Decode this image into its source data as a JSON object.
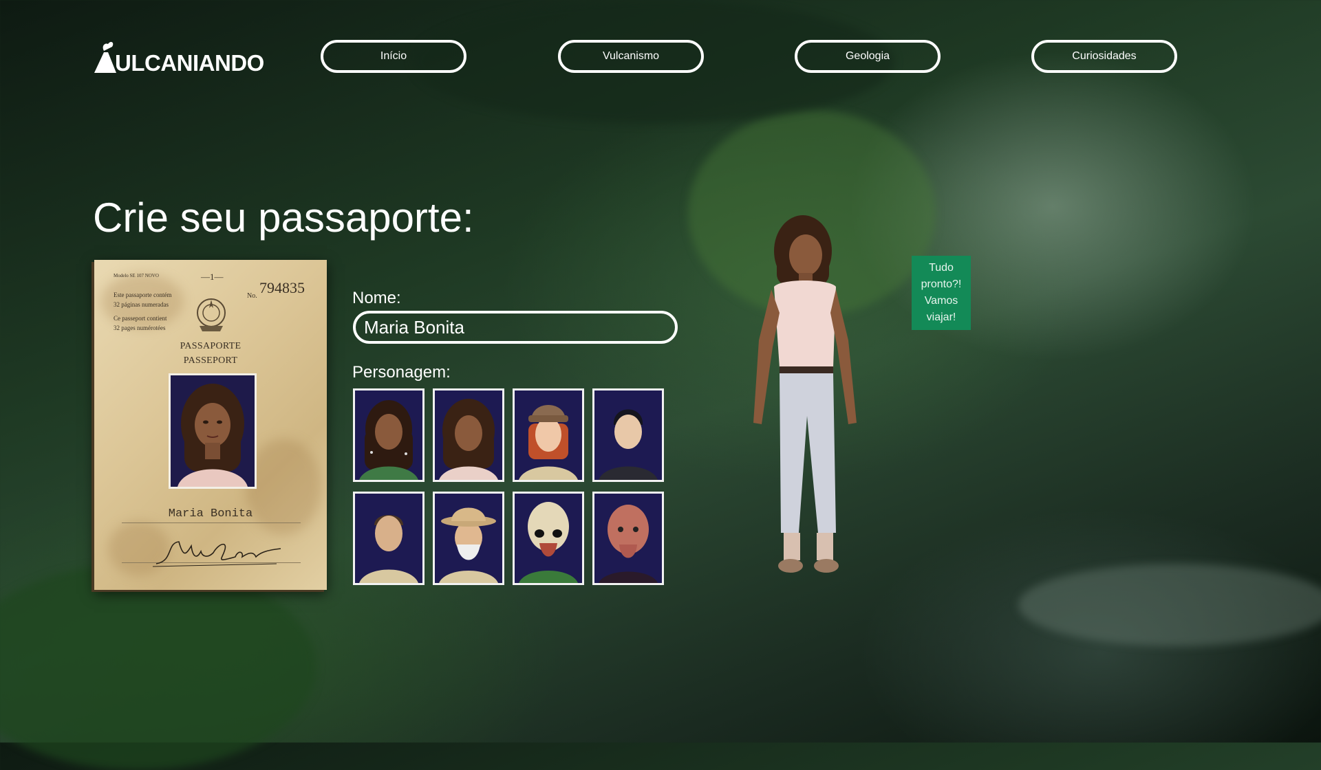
{
  "header": {
    "logo_text": "ULCANIANDO",
    "logo_glyph": "volcano-v-icon",
    "nav": [
      {
        "label": "Início"
      },
      {
        "label": "Vulcanismo"
      },
      {
        "label": "Geologia"
      },
      {
        "label": "Curiosidades"
      }
    ]
  },
  "main": {
    "title": "Crie seu passaporte:",
    "passport": {
      "header_left": "Modelo SE 107 NOVO",
      "page_mark": "—1—",
      "number_prefix": "No.",
      "number": "794835",
      "notes": [
        "Este passaporte contém",
        "32 páginas numeradas",
        "Ce passeport contient",
        "32 pages numérotées"
      ],
      "title_pt": "PASSAPORTE",
      "title_en": "PASSEPORT",
      "holder_name": "Maria Bonita",
      "signature": "Maria Bonita"
    },
    "form": {
      "name_label": "Nome:",
      "name_value": "Maria Bonita",
      "character_label": "Personagem:",
      "characters": [
        {
          "icon": "woman-braids-portrait"
        },
        {
          "icon": "woman-curly-portrait"
        },
        {
          "icon": "redhead-hat-portrait"
        },
        {
          "icon": "man-dark-hair-portrait"
        },
        {
          "icon": "man-buzzcut-portrait"
        },
        {
          "icon": "explorer-old-man-portrait"
        },
        {
          "icon": "alien-gray-portrait"
        },
        {
          "icon": "alien-pink-portrait"
        }
      ]
    },
    "ready_button": "Tudo pronto?! Vamos viajar!"
  },
  "colors": {
    "ready_button_bg": "#138a57",
    "portrait_bg": "#1d1a52",
    "outline": "#ffffff"
  }
}
